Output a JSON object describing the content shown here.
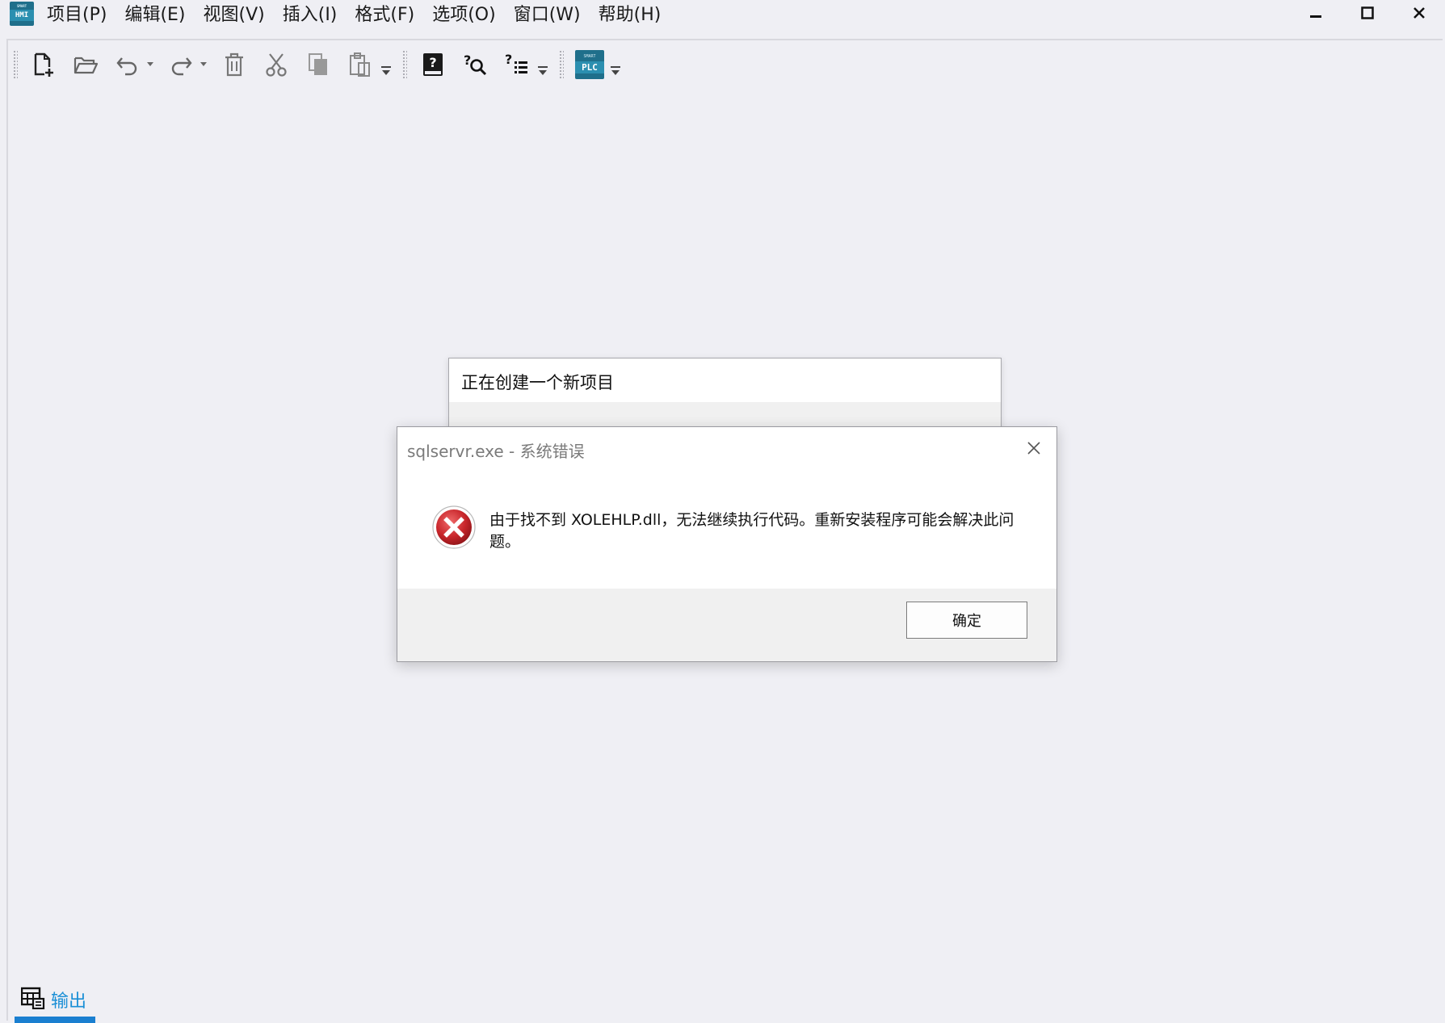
{
  "app": {
    "logo_small": "SMART",
    "logo_big": "HMI"
  },
  "menu": {
    "items": [
      "项目(P)",
      "编辑(E)",
      "视图(V)",
      "插入(I)",
      "格式(F)",
      "选项(O)",
      "窗口(W)",
      "帮助(H)"
    ]
  },
  "window_controls": [
    "minimize-icon",
    "maximize-icon",
    "close-icon"
  ],
  "toolbar": {
    "icons": [
      "new-file-icon",
      "open-folder-icon",
      "undo-icon",
      "redo-icon",
      "delete-icon",
      "cut-icon",
      "copy-icon",
      "paste-icon",
      "help-book-icon",
      "find-help-icon",
      "help-list-icon",
      "smart-plc-icon"
    ],
    "plc_small": "SMART",
    "plc_big": "PLC"
  },
  "progress_dialog": {
    "title": "正在创建一个新项目"
  },
  "error_dialog": {
    "title": "sqlservr.exe - 系统错误",
    "message": "由于找不到 XOLEHLP.dll，无法继续执行代码。重新安装程序可能会解决此问题。",
    "ok_label": "确定"
  },
  "output_tab": {
    "label": "输出"
  },
  "colors": {
    "background": "#efeff4",
    "accent": "#1a7fd0",
    "error_red": "#c8262b",
    "logo": "#1f6f8b"
  }
}
